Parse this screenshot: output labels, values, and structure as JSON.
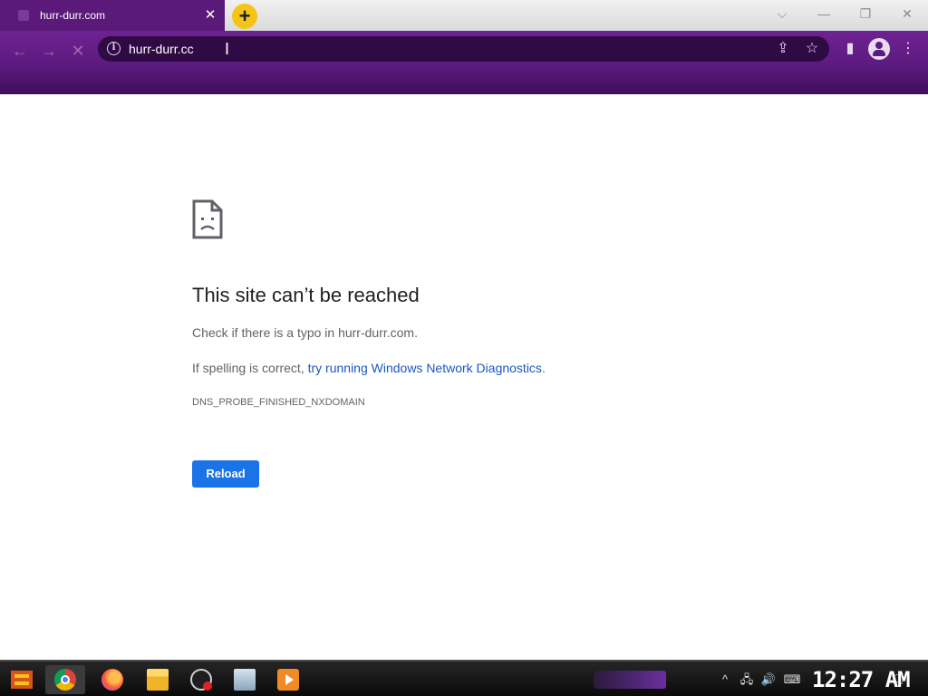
{
  "window": {
    "tab_title": "hurr-durr.com",
    "tab_close": "✕",
    "new_tab": "+",
    "controls": [
      "⌵",
      "—",
      "❐",
      "✕"
    ]
  },
  "toolbar": {
    "back": "←",
    "forward": "→",
    "stop": "✕",
    "url": "hurr-durr.cc",
    "info_icon": "i",
    "share_icon": "⇪",
    "star_icon": "☆",
    "side_panel_icon": "▮",
    "menu_icon": "⋮"
  },
  "error": {
    "title": "This site can’t be reached",
    "line1": "Check if there is a typo in hurr-durr.com.",
    "line2_prefix": "If spelling is correct, ",
    "line2_link": "try running Windows Network Diagnostics",
    "line2_suffix": ".",
    "code": "DNS_PROBE_FINISHED_NXDOMAIN",
    "reload_label": "Reload"
  },
  "taskbar": {
    "pins": [
      "chrome-icon",
      "firefox-icon",
      "file-explorer-icon",
      "obs-icon",
      "image-viewer-icon",
      "media-player-icon"
    ],
    "tray": [
      "^",
      "🖧",
      "🔊",
      "⌨",
      "🗨"
    ],
    "clock": "12:27 AM"
  },
  "colors": {
    "accent": "#5c1a7e",
    "omnibox": "#300a45",
    "link": "#1a56c4",
    "button": "#1a73e8",
    "new_tab": "#f6c417"
  }
}
